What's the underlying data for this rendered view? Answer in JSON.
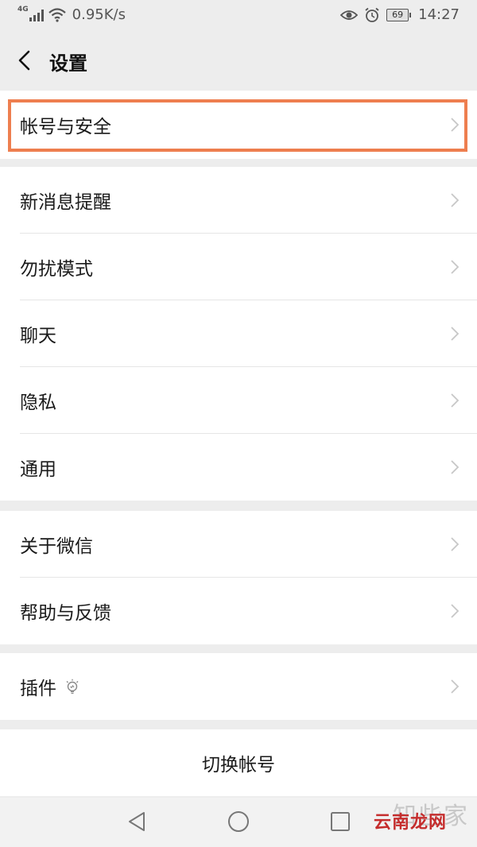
{
  "status_bar": {
    "network": "4G",
    "speed": "0.95K/s",
    "battery": "69",
    "time": "14:27"
  },
  "header": {
    "title": "设置"
  },
  "groups": [
    {
      "items": [
        {
          "label": "帐号与安全",
          "highlighted": true
        }
      ]
    },
    {
      "items": [
        {
          "label": "新消息提醒"
        },
        {
          "label": "勿扰模式"
        },
        {
          "label": "聊天"
        },
        {
          "label": "隐私"
        },
        {
          "label": "通用"
        }
      ]
    },
    {
      "items": [
        {
          "label": "关于微信"
        },
        {
          "label": "帮助与反馈"
        }
      ]
    },
    {
      "items": [
        {
          "label": "插件",
          "icon": "bulb-icon"
        }
      ]
    }
  ],
  "switch_account": {
    "label": "切换帐号"
  },
  "highlight_color": "#ee7e4f",
  "watermark": {
    "text": "云南龙网",
    "ghost_text": "知些家"
  },
  "nav_bar": {
    "icons": [
      "back-triangle-icon",
      "home-circle-icon",
      "recent-square-icon"
    ]
  }
}
